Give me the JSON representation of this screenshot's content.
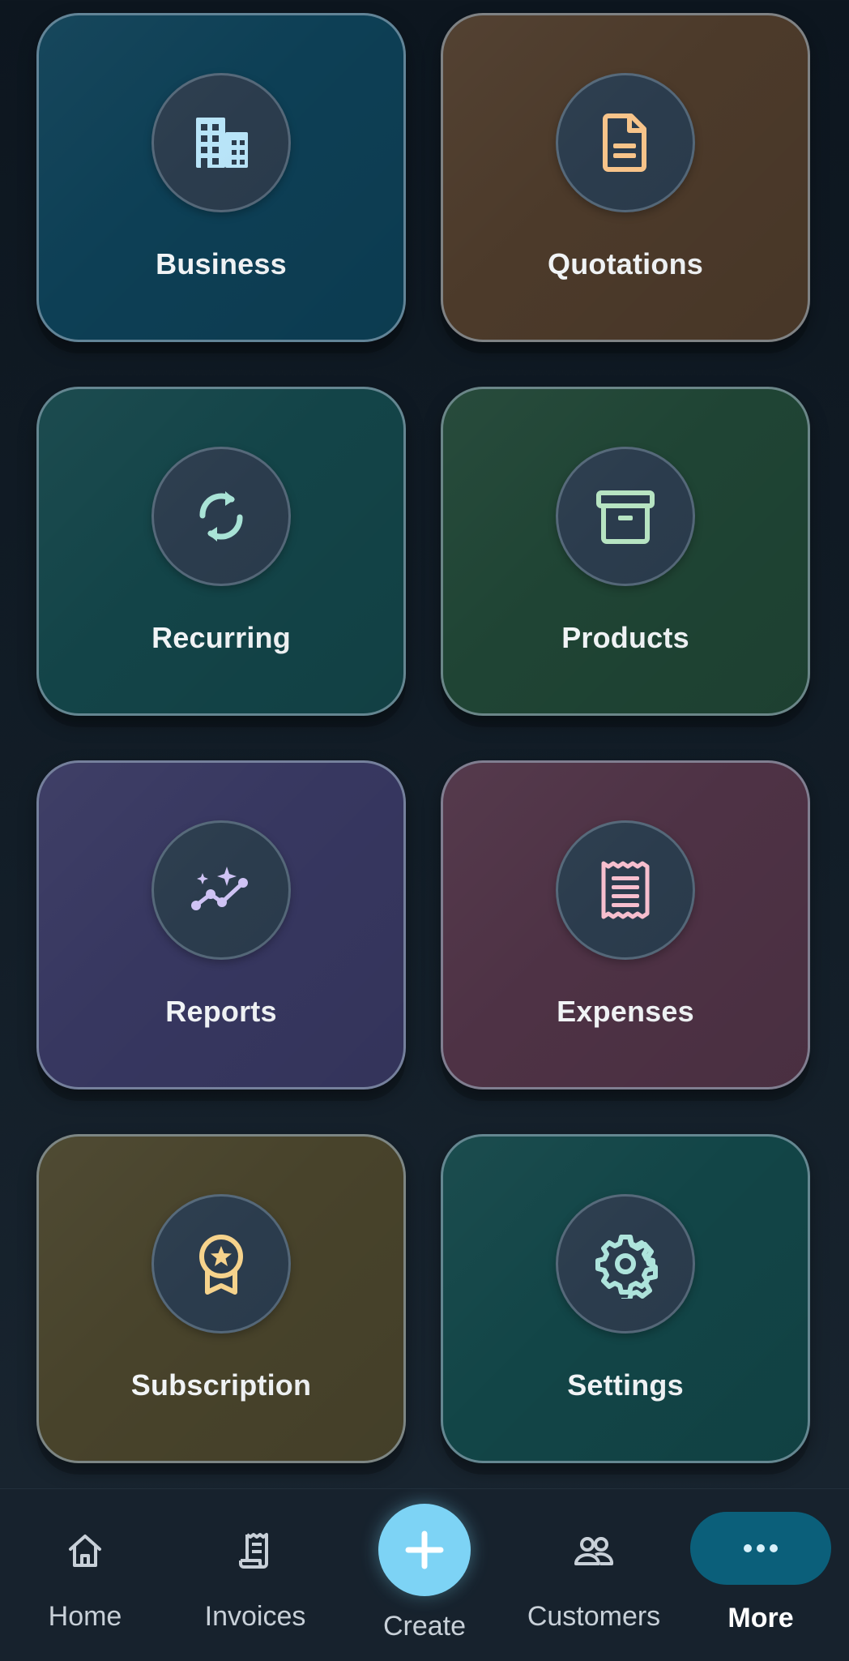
{
  "tiles": [
    {
      "label": "Business",
      "icon": "building-icon",
      "bg": "#0d3f55",
      "icon_color": "#b8e4f8"
    },
    {
      "label": "Quotations",
      "icon": "document-icon",
      "bg": "#4c3a2a",
      "icon_color": "#f8c48a"
    },
    {
      "label": "Recurring",
      "icon": "refresh-icon",
      "bg": "#134448",
      "icon_color": "#a9e3d6"
    },
    {
      "label": "Products",
      "icon": "archive-box-icon",
      "bg": "#1f4434",
      "icon_color": "#b7e4c2"
    },
    {
      "label": "Reports",
      "icon": "trend-sparkle-icon",
      "bg": "#373760",
      "icon_color": "#cfc3f4"
    },
    {
      "label": "Expenses",
      "icon": "receipt-icon",
      "bg": "#4e3245",
      "icon_color": "#f7bfcf"
    },
    {
      "label": "Subscription",
      "icon": "award-badge-icon",
      "bg": "#48432b",
      "icon_color": "#f6d38c"
    },
    {
      "label": "Settings",
      "icon": "gear-icon",
      "bg": "#124547",
      "icon_color": "#aee4dc"
    }
  ],
  "bottom_nav": {
    "home": {
      "label": "Home",
      "icon": "home-icon"
    },
    "invoices": {
      "label": "Invoices",
      "icon": "invoice-icon"
    },
    "create": {
      "label": "Create",
      "icon": "plus-icon"
    },
    "customers": {
      "label": "Customers",
      "icon": "users-icon"
    },
    "more": {
      "label": "More",
      "icon": "more-dots-icon",
      "active": true
    }
  },
  "colors": {
    "accent": "#7dd3f5",
    "active_pill": "#0b5f7a"
  }
}
